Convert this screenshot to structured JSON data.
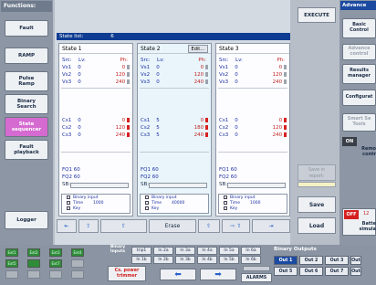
{
  "functions": {
    "header": "Functions:",
    "items": [
      {
        "label": "Fault",
        "active": false
      },
      {
        "label": "RAMP",
        "active": false
      },
      {
        "label": "Pulse\nRamp",
        "active": false
      },
      {
        "label": "Binary\nSearch",
        "active": false
      },
      {
        "label": "State\nsequencer",
        "active": true
      },
      {
        "label": "Fault\nplayback",
        "active": false
      }
    ],
    "logger": "Logger"
  },
  "execute": "EXECUTE",
  "state_list": {
    "label": "State list:",
    "count": "6"
  },
  "states": [
    {
      "title": "State 1",
      "has_edit": false,
      "selected": false,
      "header": {
        "c1": "Src:",
        "c2": "Lv:",
        "c3": "Ph:"
      },
      "vrows": [
        {
          "n": "Vs1",
          "a": "0",
          "p": "0",
          "red": false
        },
        {
          "n": "Vs2",
          "a": "0",
          "p": "120",
          "red": false
        },
        {
          "n": "Vs3",
          "a": "0",
          "p": "240",
          "red": false
        }
      ],
      "crows": [
        {
          "n": "Cs1",
          "a": "0",
          "p": "0",
          "red": true
        },
        {
          "n": "Cs2",
          "a": "0",
          "p": "120",
          "red": true
        },
        {
          "n": "Cs3",
          "a": "0",
          "p": "240",
          "red": true
        }
      ],
      "fq1": "FQ1 60",
      "fq2": "FQ2 60",
      "sb": "SB:",
      "trigger": {
        "binary": "Binary input",
        "time_label": "Time",
        "time_value": "1000",
        "key": "Key"
      }
    },
    {
      "title": "State 2",
      "has_edit": true,
      "edit": "Edit...",
      "selected": true,
      "header": {
        "c1": "Src:",
        "c2": "Lv:",
        "c3": "Ph:"
      },
      "vrows": [
        {
          "n": "Vs1",
          "a": "0",
          "p": "0",
          "red": false
        },
        {
          "n": "Vs2",
          "a": "0",
          "p": "120",
          "red": false
        },
        {
          "n": "Vs3",
          "a": "0",
          "p": "240",
          "red": false
        }
      ],
      "crows": [
        {
          "n": "Cs1",
          "a": "5",
          "p": "0",
          "red": true
        },
        {
          "n": "Cs2",
          "a": "5",
          "p": "180",
          "red": true
        },
        {
          "n": "Cs3",
          "a": "5",
          "p": "240",
          "red": true
        }
      ],
      "fq1": "FQ1 60",
      "fq2": "FQ2 60",
      "sb": "SB:",
      "trigger": {
        "binary": "Binary input",
        "time_label": "Time",
        "time_value": "40000",
        "key": "Key"
      }
    },
    {
      "title": "State 3",
      "has_edit": false,
      "selected": false,
      "header": {
        "c1": "Src:",
        "c2": "Lv:",
        "c3": "Ph:"
      },
      "vrows": [
        {
          "n": "Vs1",
          "a": "0",
          "p": "0",
          "red": false
        },
        {
          "n": "Vs2",
          "a": "0",
          "p": "120",
          "red": false
        },
        {
          "n": "Vs3",
          "a": "0",
          "p": "240",
          "red": false
        }
      ],
      "crows": [
        {
          "n": "Cs1",
          "a": "0",
          "p": "0",
          "red": true
        },
        {
          "n": "Cs2",
          "a": "0",
          "p": "120",
          "red": true
        },
        {
          "n": "Cs3",
          "a": "0",
          "p": "240",
          "red": true
        }
      ],
      "fq1": "FQ1 60",
      "fq2": "FQ2 60",
      "sb": "SB:",
      "trigger": {
        "binary": "Binary input",
        "time_label": "Time",
        "time_value": "1000",
        "key": "Key"
      }
    }
  ],
  "nav": {
    "erase": "Erase"
  },
  "save_in_report": "Save in\nreport:",
  "save": "Save",
  "load": "Load",
  "advanced": {
    "header": "Advance",
    "items": [
      {
        "label": "Basic\nControl",
        "dim": false
      },
      {
        "label": "Advance\ncontrol",
        "dim": true
      },
      {
        "label": "Results\nmanager",
        "dim": false
      },
      {
        "label": "Configurat",
        "dim": false
      },
      {
        "label": "Smart Se\nTools",
        "dim": true
      }
    ],
    "on_label": "ON",
    "remote": "Remo\ncontr",
    "off_label": "OFF",
    "off_value": "12",
    "battery": "Batte\nsimula"
  },
  "bottom": {
    "leds": [
      {
        "label": "Ext1",
        "on": true
      },
      {
        "label": "Ext2",
        "on": true
      },
      {
        "label": "Ext3",
        "on": true
      },
      {
        "label": "Ext4",
        "on": true
      },
      {
        "label": "Ext5",
        "on": true
      },
      {
        "label": "",
        "on": true
      },
      {
        "label": "Ext7",
        "on": true
      },
      {
        "label": "",
        "on": false
      },
      {
        "label": "",
        "on": false
      },
      {
        "label": "",
        "on": false
      },
      {
        "label": "",
        "on": false
      },
      {
        "label": "",
        "on": false
      }
    ],
    "binary_inputs_label": "Binary\nInputs",
    "bi_row1": [
      "trip1",
      "In 2a",
      "In 3a",
      "In 4a",
      "In 5a",
      "In 6a"
    ],
    "bi_row2": [
      "In 1b",
      "In 2b",
      "In 3b",
      "In 4b",
      "In 5b",
      "In 6b"
    ],
    "cs_power": "Cs. power\ntrimmer",
    "alarms": "ALARMS",
    "binary_outputs_label": "Binary Outputs",
    "outputs": [
      {
        "label": "Out 1",
        "on": true
      },
      {
        "label": "Out 2",
        "on": false
      },
      {
        "label": "Out 3",
        "on": false
      },
      {
        "label": "Out",
        "on": false
      },
      {
        "label": "Out 5",
        "on": false
      },
      {
        "label": "Out 6",
        "on": false
      },
      {
        "label": "Out 7",
        "on": false
      },
      {
        "label": "Out",
        "on": false
      }
    ]
  }
}
